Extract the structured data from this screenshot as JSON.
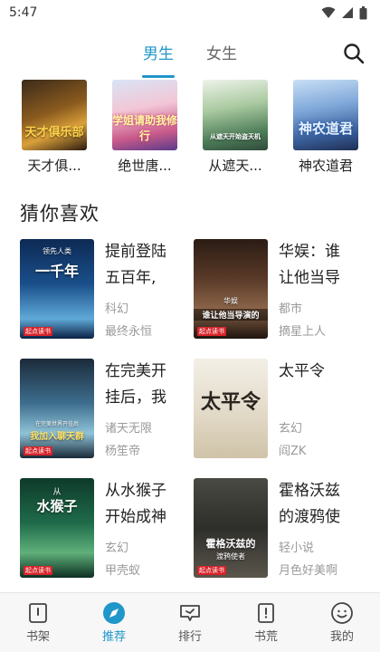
{
  "status": {
    "time": "5:47"
  },
  "tabs": [
    {
      "label": "男生",
      "active": true
    },
    {
      "label": "女生",
      "active": false
    }
  ],
  "top_books": [
    {
      "title": "天才俱...",
      "cover_text": "天才俱乐部"
    },
    {
      "title": "绝世唐...",
      "cover_text": "学姐请助我修行"
    },
    {
      "title": "从遮天...",
      "cover_text": "从遮天开始盗天机"
    },
    {
      "title": "神农道君",
      "cover_text": "神农道君"
    }
  ],
  "section": {
    "title": "猜你喜欢"
  },
  "books": [
    {
      "title": "提前登陆五百年,",
      "category": "科幻",
      "author": "最终永恒",
      "cover_text": "一千年",
      "cover_sub": "领先人类"
    },
    {
      "title": "华娱：谁让他当导",
      "category": "都市",
      "author": "摘星上人",
      "cover_text": "谁让他当导演的",
      "cover_sub": "华娱"
    },
    {
      "title": "在完美开挂后，我",
      "category": "诸天无限",
      "author": "杨笙帝",
      "cover_text": "我加入聊天群",
      "cover_sub": "在完美世界开挂后"
    },
    {
      "title": "太平令",
      "category": "玄幻",
      "author": "阎ZK",
      "cover_text": "太平令",
      "cover_sub": ""
    },
    {
      "title": "从水猴子开始成神",
      "category": "玄幻",
      "author": "甲壳蚁",
      "cover_text": "水猴子",
      "cover_sub": "从"
    },
    {
      "title": "霍格沃兹的渡鸦使",
      "category": "轻小说",
      "author": "月色好美啊",
      "cover_text": "霍格沃兹的",
      "cover_sub": "渡鸦使者"
    }
  ],
  "publisher_badge": "起点读书",
  "bottom_nav": [
    {
      "label": "书架",
      "icon": "bookshelf-icon",
      "active": false
    },
    {
      "label": "推荐",
      "icon": "compass-icon",
      "active": true
    },
    {
      "label": "排行",
      "icon": "ranking-icon",
      "active": false
    },
    {
      "label": "书荒",
      "icon": "book-request-icon",
      "active": false
    },
    {
      "label": "我的",
      "icon": "profile-icon",
      "active": false
    }
  ],
  "colors": {
    "accent": "#2196c9"
  }
}
